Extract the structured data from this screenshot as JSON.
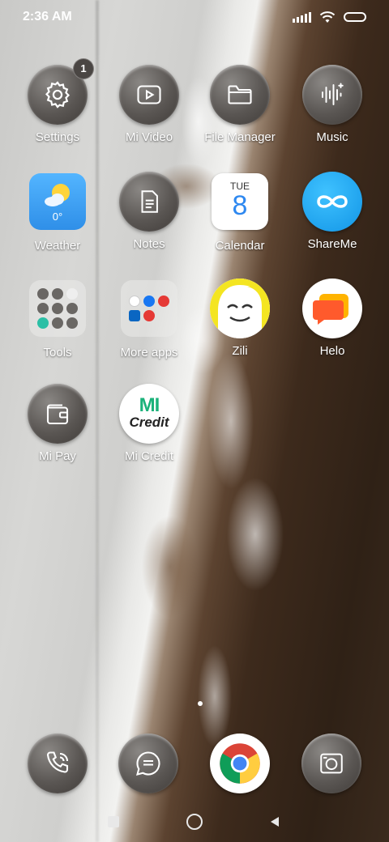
{
  "status_bar": {
    "time": "2:36 AM"
  },
  "apps": {
    "settings": {
      "label": "Settings",
      "badge": "1",
      "icon": "gear-icon"
    },
    "mi_video": {
      "label": "Mi Video",
      "icon": "play-icon"
    },
    "file_manager": {
      "label": "File Manager",
      "icon": "folder-icon"
    },
    "music": {
      "label": "Music",
      "icon": "soundwave-icon"
    },
    "weather": {
      "label": "Weather",
      "temp": "0°",
      "icon": "weather-sun-cloud-icon"
    },
    "notes": {
      "label": "Notes",
      "icon": "note-icon"
    },
    "calendar": {
      "label": "Calendar",
      "weekday": "TUE",
      "day": "8",
      "icon": "calendar-icon"
    },
    "shareme": {
      "label": "ShareMe",
      "icon": "infinity-icon"
    },
    "tools": {
      "label": "Tools",
      "icon": "folder-icon"
    },
    "more_apps": {
      "label": "More apps",
      "icon": "folder-icon"
    },
    "zili": {
      "label": "Zili",
      "icon": "zili-face-icon"
    },
    "helo": {
      "label": "Helo",
      "icon": "helo-chat-icon"
    },
    "mi_pay": {
      "label": "Mi Pay",
      "icon": "wallet-icon"
    },
    "mi_credit": {
      "label": "Mi Credit",
      "logo_top": "MI",
      "logo_bottom": "Credit"
    }
  },
  "dock": {
    "phone": {
      "icon": "phone-icon"
    },
    "messages": {
      "icon": "message-icon"
    },
    "chrome": {
      "icon": "chrome-icon"
    },
    "camera": {
      "icon": "camera-icon"
    }
  },
  "navbar": {
    "recents": "recents-icon",
    "home": "home-icon",
    "back": "back-icon"
  },
  "colors": {
    "accent_blue": "#2e88f0",
    "weather_blue": "#3fa4f5",
    "shareme_blue": "#1a9bee",
    "micredit_green": "#1bb27a",
    "helo_orange": "#ff5a2c"
  }
}
